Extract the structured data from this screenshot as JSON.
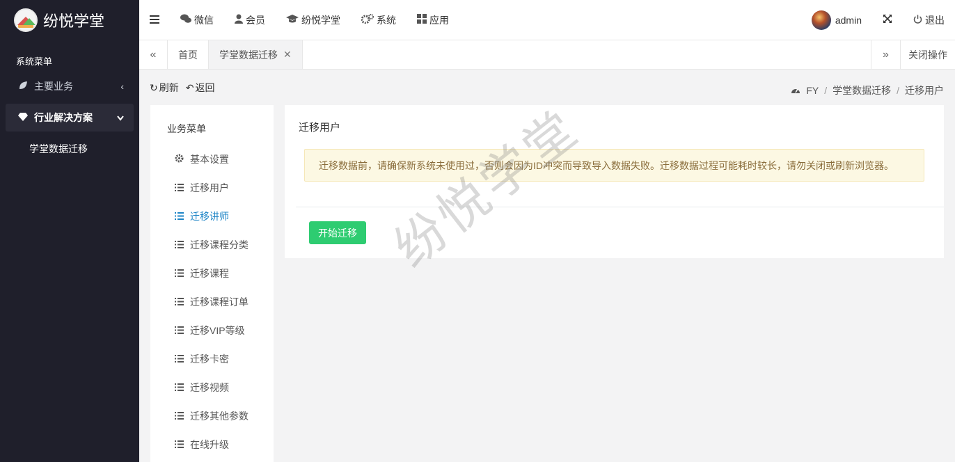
{
  "sidebar": {
    "brand": "纷悦学堂",
    "menu_header": "系统菜单",
    "items": [
      {
        "label": "主要业务",
        "icon": "leaf-icon",
        "arrow": "‹"
      },
      {
        "label": "行业解决方案",
        "icon": "diamond-icon",
        "arrow": "⌄"
      }
    ],
    "subitems": [
      {
        "label": "学堂数据迁移"
      }
    ]
  },
  "topbar": {
    "menu_toggle": "≡",
    "items": [
      {
        "label": "微信",
        "icon": "comments-icon"
      },
      {
        "label": "会员",
        "icon": "user-icon"
      },
      {
        "label": "纷悦学堂",
        "icon": "graduation-cap-icon"
      },
      {
        "label": "系统",
        "icon": "cogs-icon"
      },
      {
        "label": "应用",
        "icon": "th-large-icon"
      }
    ],
    "username": "admin",
    "logout": "退出"
  },
  "tabs": {
    "items": [
      {
        "label": "首页"
      },
      {
        "label": "学堂数据迁移",
        "close": "✕"
      }
    ],
    "close_ops": "关闭操作"
  },
  "content": {
    "refresh": "刷新",
    "back": "返回",
    "breadcrumb": [
      "FY",
      "学堂数据迁移",
      "迁移用户"
    ],
    "left_panel": {
      "title": "业务菜单",
      "items": [
        {
          "label": "基本设置",
          "icon": "gear-icon"
        },
        {
          "label": "迁移用户",
          "icon": "list-icon"
        },
        {
          "label": "迁移讲师",
          "icon": "list-icon"
        },
        {
          "label": "迁移课程分类",
          "icon": "list-icon"
        },
        {
          "label": "迁移课程",
          "icon": "list-icon"
        },
        {
          "label": "迁移课程订单",
          "icon": "list-icon"
        },
        {
          "label": "迁移VIP等级",
          "icon": "list-icon"
        },
        {
          "label": "迁移卡密",
          "icon": "list-icon"
        },
        {
          "label": "迁移视频",
          "icon": "list-icon"
        },
        {
          "label": "迁移其他参数",
          "icon": "list-icon"
        },
        {
          "label": "在线升级",
          "icon": "list-icon"
        }
      ]
    },
    "main": {
      "title": "迁移用户",
      "alert": "迁移数据前，请确保新系统未使用过，否则会因为ID冲突而导致导入数据失败。迁移数据过程可能耗时较长，请勿关闭或刷新浏览器。",
      "start_button": "开始迁移"
    },
    "watermark": "纷悦学堂"
  },
  "colors": {
    "sidebar_bg": "#1f1f2b",
    "accent_blue": "#1c84c6",
    "button_green": "#2ecc71",
    "alert_bg": "#fcf8e3",
    "alert_text": "#8a6d3b"
  }
}
